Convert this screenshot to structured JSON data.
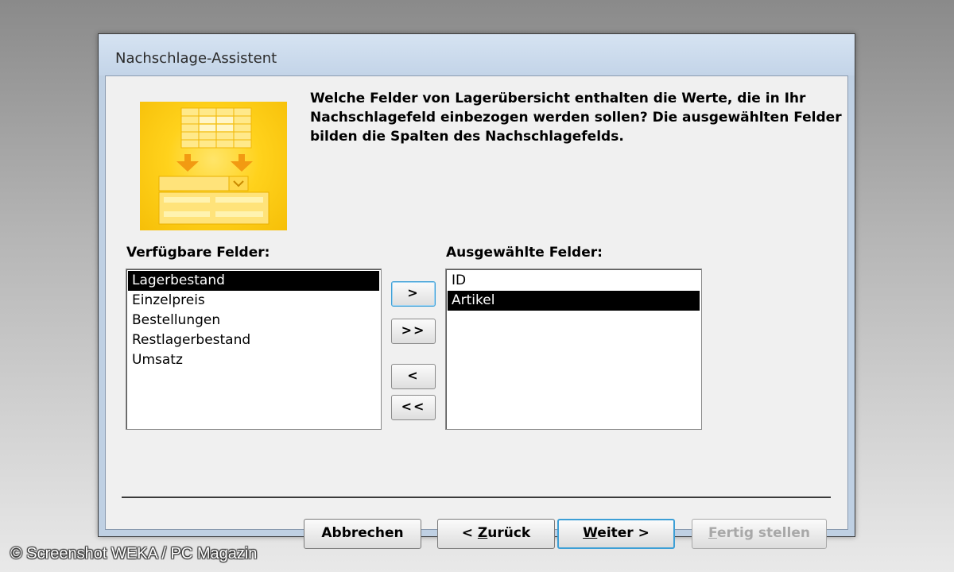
{
  "window": {
    "title": "Nachschlage-Assistent"
  },
  "instructions": "Welche Felder von Lagerübersicht enthalten die Werte, die in Ihr Nachschlagefeld einbezogen werden sollen? Die ausgewählten Felder bilden die Spalten des Nachschlagefelds.",
  "available": {
    "label": "Verfügbare Felder:",
    "items": [
      "Lagerbestand",
      "Einzelpreis",
      "Bestellungen",
      "Restlagerbestand",
      "Umsatz"
    ],
    "selected_index": 0
  },
  "selected_fields": {
    "label": "Ausgewählte Felder:",
    "items": [
      "ID",
      "Artikel"
    ],
    "selected_index": 1
  },
  "move_buttons": {
    "add_one": ">",
    "add_all": ">>",
    "remove_one": "<",
    "remove_all": "<<"
  },
  "footer": {
    "cancel": "Abbrechen",
    "back_prefix": "< ",
    "back_mnemonic": "Z",
    "back_rest": "urück",
    "next_mnemonic": "W",
    "next_rest": "eiter >",
    "finish_mnemonic": "F",
    "finish_rest": "ertig stellen",
    "finish_enabled": false
  },
  "watermark": "© Screenshot WEKA / PC Magazin",
  "colors": {
    "wizard_yellow": "#ffd21c",
    "selection": "#000000",
    "focus_blue": "#3c9fd6"
  }
}
